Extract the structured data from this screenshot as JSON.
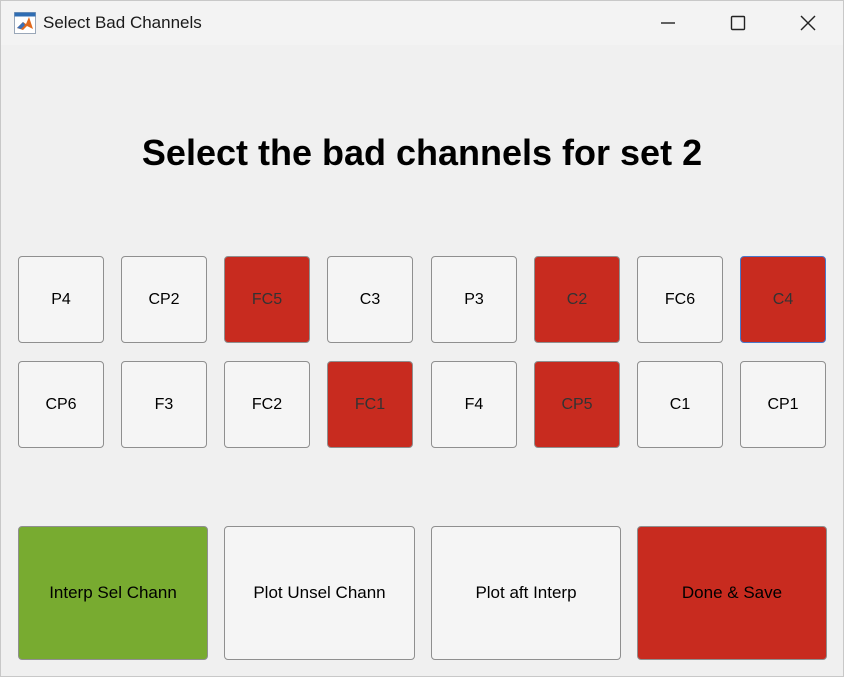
{
  "window": {
    "title": "Select Bad Channels",
    "app_icon": "matlab-icon"
  },
  "heading": "Select the bad channels for set 2",
  "colors": {
    "selected": "#c82b1f",
    "interp_button": "#78ab30",
    "done_button": "#c82b1f",
    "default_button": "#f5f5f5"
  },
  "channels": [
    {
      "label": "P4",
      "selected": false
    },
    {
      "label": "CP2",
      "selected": false
    },
    {
      "label": "FC5",
      "selected": true
    },
    {
      "label": "C3",
      "selected": false
    },
    {
      "label": "P3",
      "selected": false
    },
    {
      "label": "C2",
      "selected": true
    },
    {
      "label": "FC6",
      "selected": false
    },
    {
      "label": "C4",
      "selected": true
    },
    {
      "label": "CP6",
      "selected": false
    },
    {
      "label": "F3",
      "selected": false
    },
    {
      "label": "FC2",
      "selected": false
    },
    {
      "label": "FC1",
      "selected": true
    },
    {
      "label": "F4",
      "selected": false
    },
    {
      "label": "CP5",
      "selected": true
    },
    {
      "label": "C1",
      "selected": false
    },
    {
      "label": "CP1",
      "selected": false
    }
  ],
  "actions": {
    "interp": "Interp Sel Chann",
    "plot_unsel": "Plot Unsel Chann",
    "plot_aft": "Plot aft Interp",
    "done": "Done & Save"
  }
}
